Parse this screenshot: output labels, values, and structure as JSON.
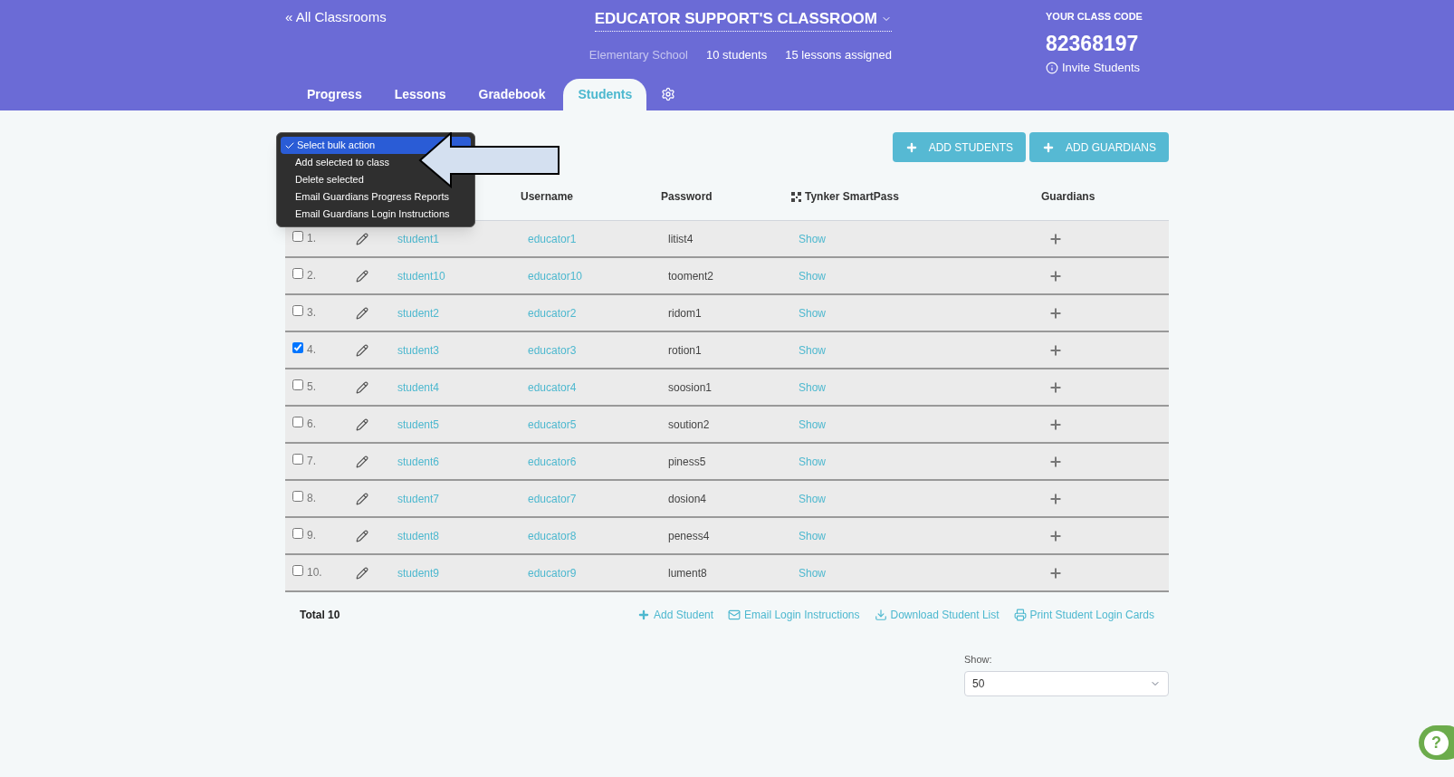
{
  "header": {
    "back_link": "« All Classrooms",
    "classroom_title": "EDUCATOR SUPPORT'S CLASSROOM",
    "school": "Elementary School",
    "student_count": "10 students",
    "lessons": "15 lessons assigned",
    "class_code_label": "YOUR CLASS CODE",
    "class_code": "82368197",
    "invite_link": "Invite Students"
  },
  "tabs": [
    {
      "label": "Progress",
      "selected": false
    },
    {
      "label": "Lessons",
      "selected": false
    },
    {
      "label": "Gradebook",
      "selected": false
    },
    {
      "label": "Students",
      "selected": true
    }
  ],
  "bulk_menu": {
    "options": [
      {
        "label": "Select bulk action",
        "selected": true
      },
      {
        "label": "Add selected to class",
        "selected": false
      },
      {
        "label": "Delete selected",
        "selected": false
      },
      {
        "label": "Email Guardians Progress Reports",
        "selected": false
      },
      {
        "label": "Email Guardians Login Instructions",
        "selected": false
      }
    ]
  },
  "buttons": [
    "ADD STUDENTS",
    "ADD GUARDIANS"
  ],
  "table": {
    "columns": [
      "Username",
      "Password",
      "Tynker SmartPass",
      "Guardians"
    ],
    "rows": [
      {
        "number": "1.",
        "checked": false,
        "name": "student1",
        "username": "educator1",
        "password": "litist4",
        "smartpass": "Show"
      },
      {
        "number": "2.",
        "checked": false,
        "name": "student10",
        "username": "educator10",
        "password": "tooment2",
        "smartpass": "Show"
      },
      {
        "number": "3.",
        "checked": false,
        "name": "student2",
        "username": "educator2",
        "password": "ridom1",
        "smartpass": "Show"
      },
      {
        "number": "4.",
        "checked": true,
        "name": "student3",
        "username": "educator3",
        "password": "rotion1",
        "smartpass": "Show"
      },
      {
        "number": "5.",
        "checked": false,
        "name": "student4",
        "username": "educator4",
        "password": "soosion1",
        "smartpass": "Show"
      },
      {
        "number": "6.",
        "checked": false,
        "name": "student5",
        "username": "educator5",
        "password": "soution2",
        "smartpass": "Show"
      },
      {
        "number": "7.",
        "checked": false,
        "name": "student6",
        "username": "educator6",
        "password": "piness5",
        "smartpass": "Show"
      },
      {
        "number": "8.",
        "checked": false,
        "name": "student7",
        "username": "educator7",
        "password": "dosion4",
        "smartpass": "Show"
      },
      {
        "number": "9.",
        "checked": false,
        "name": "student8",
        "username": "educator8",
        "password": "peness4",
        "smartpass": "Show"
      },
      {
        "number": "10.",
        "checked": false,
        "name": "student9",
        "username": "educator9",
        "password": "lument8",
        "smartpass": "Show"
      }
    ]
  },
  "footer": {
    "total": "Total 10",
    "actions": [
      {
        "kind": "add",
        "label": "Add Student"
      },
      {
        "kind": "email",
        "label": "Email Login Instructions"
      },
      {
        "kind": "download",
        "label": "Download Student List"
      },
      {
        "kind": "print",
        "label": "Print Student Login Cards"
      }
    ]
  },
  "page_size": {
    "label": "Show:",
    "value": "50"
  },
  "help_button": {
    "label": "?"
  }
}
